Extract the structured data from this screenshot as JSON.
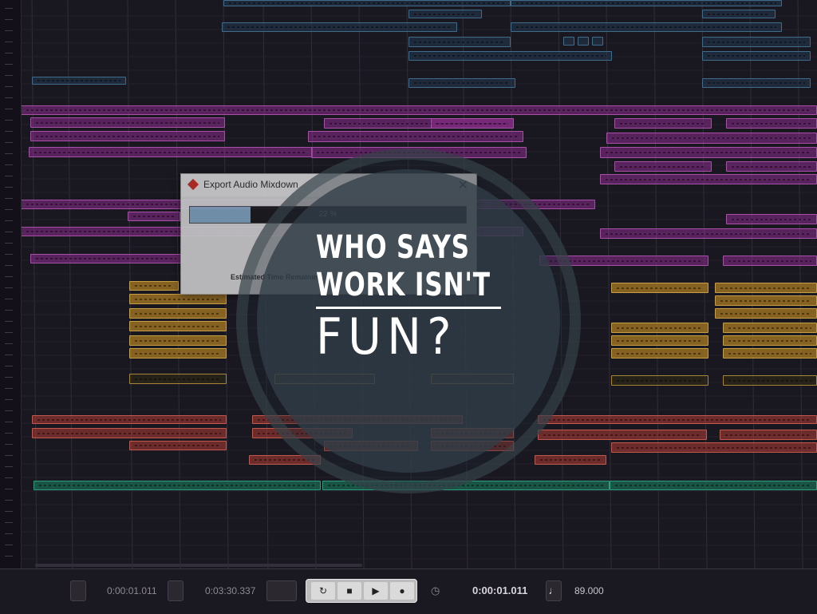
{
  "dialog": {
    "title": "Export Audio Mixdown",
    "close_glyph": "✕",
    "progress_percent": 22,
    "progress_label": "22 %",
    "remaining_label": "Estimated Time Remaining:"
  },
  "slogan": {
    "line1": "WHO SAYS",
    "line2": "WORK ISN'T",
    "line3": "FUN?"
  },
  "transport": {
    "left_locator": "0:00:01.011",
    "right_locator": "0:03:30.337",
    "position": "0:00:01.011",
    "tempo": "89.000",
    "icons": {
      "cycle": "↻",
      "stop": "■",
      "play": "▶",
      "record": "●",
      "metronome": "♩",
      "clock": "◷"
    }
  },
  "colors": {
    "blue_track": "#4b82a6",
    "purple_track": "#c861c8",
    "yellow_track": "#f0c050",
    "red_track": "#e86a5a",
    "green_track": "#36c095",
    "background": "#1d1a24"
  }
}
